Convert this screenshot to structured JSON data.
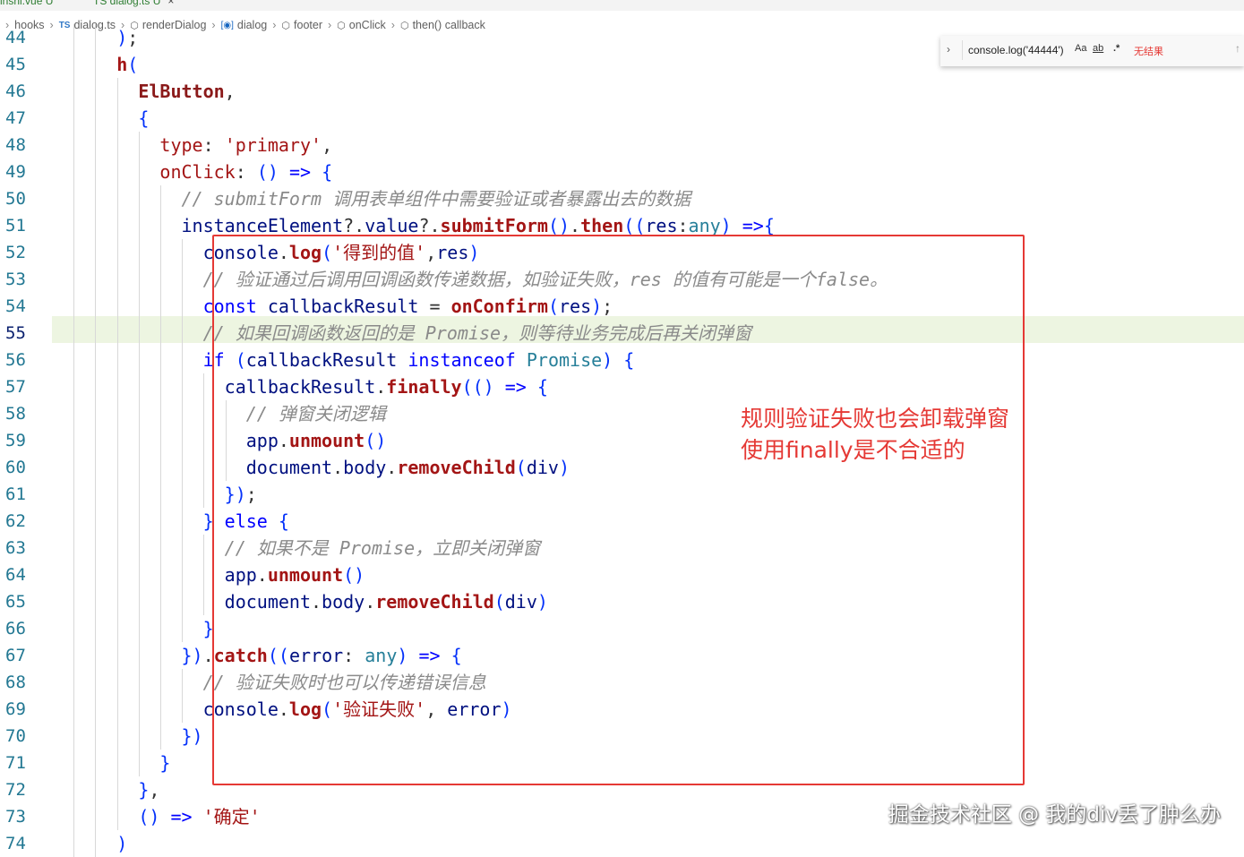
{
  "tabs": [
    {
      "label": "inshi.vue U"
    },
    {
      "label": "TS dialog.ts U",
      "close": "×"
    }
  ],
  "breadcrumb": {
    "items": [
      "hooks",
      "dialog.ts",
      "renderDialog",
      "dialog",
      "footer",
      "onClick",
      "then() callback"
    ]
  },
  "find_widget": {
    "query": "console.log('44444')",
    "match_case": "Aa",
    "whole_word": "ab",
    "regex": ".*",
    "result": "无结果",
    "prev": "↑"
  },
  "editor": {
    "active_line": "55",
    "lines": [
      {
        "n": "44",
        "code": "      );"
      },
      {
        "n": "45",
        "code": "      h("
      },
      {
        "n": "46",
        "code": "        ElButton,"
      },
      {
        "n": "47",
        "code": "        {"
      },
      {
        "n": "48",
        "code": "          type: 'primary',"
      },
      {
        "n": "49",
        "code": "          onClick: () => {"
      },
      {
        "n": "50",
        "code": "            // submitForm 调用表单组件中需要验证或者暴露出去的数据"
      },
      {
        "n": "51",
        "code": "            instanceElement?.value?.submitForm().then((res:any) =>{"
      },
      {
        "n": "52",
        "code": "              console.log('得到的值',res)"
      },
      {
        "n": "53",
        "code": "              // 验证通过后调用回调函数传递数据，如验证失败，res 的值有可能是一个false。"
      },
      {
        "n": "54",
        "code": "              const callbackResult = onConfirm(res);"
      },
      {
        "n": "55",
        "code": "              // 如果回调函数返回的是 Promise，则等待业务完成后再关闭弹窗"
      },
      {
        "n": "56",
        "code": "              if (callbackResult instanceof Promise) {"
      },
      {
        "n": "57",
        "code": "                callbackResult.finally(() => {"
      },
      {
        "n": "58",
        "code": "                  // 弹窗关闭逻辑"
      },
      {
        "n": "59",
        "code": "                  app.unmount()"
      },
      {
        "n": "60",
        "code": "                  document.body.removeChild(div)"
      },
      {
        "n": "61",
        "code": "                });"
      },
      {
        "n": "62",
        "code": "              } else {"
      },
      {
        "n": "63",
        "code": "                // 如果不是 Promise，立即关闭弹窗"
      },
      {
        "n": "64",
        "code": "                app.unmount()"
      },
      {
        "n": "65",
        "code": "                document.body.removeChild(div)"
      },
      {
        "n": "66",
        "code": "              }"
      },
      {
        "n": "67",
        "code": "            }).catch((error: any) => {"
      },
      {
        "n": "68",
        "code": "              // 验证失败时也可以传递错误信息"
      },
      {
        "n": "69",
        "code": "              console.log('验证失败', error)"
      },
      {
        "n": "70",
        "code": "            })"
      },
      {
        "n": "71",
        "code": "          }"
      },
      {
        "n": "72",
        "code": "        },"
      },
      {
        "n": "73",
        "code": "        () => '确定'"
      },
      {
        "n": "74",
        "code": "      )"
      }
    ]
  },
  "annotation": {
    "text": "规则验证失败也会卸载弹窗\n使用finally是不合适的",
    "color": "#e53935"
  },
  "watermark": "掘金技术社区 @ 我的div丢了肿么办"
}
